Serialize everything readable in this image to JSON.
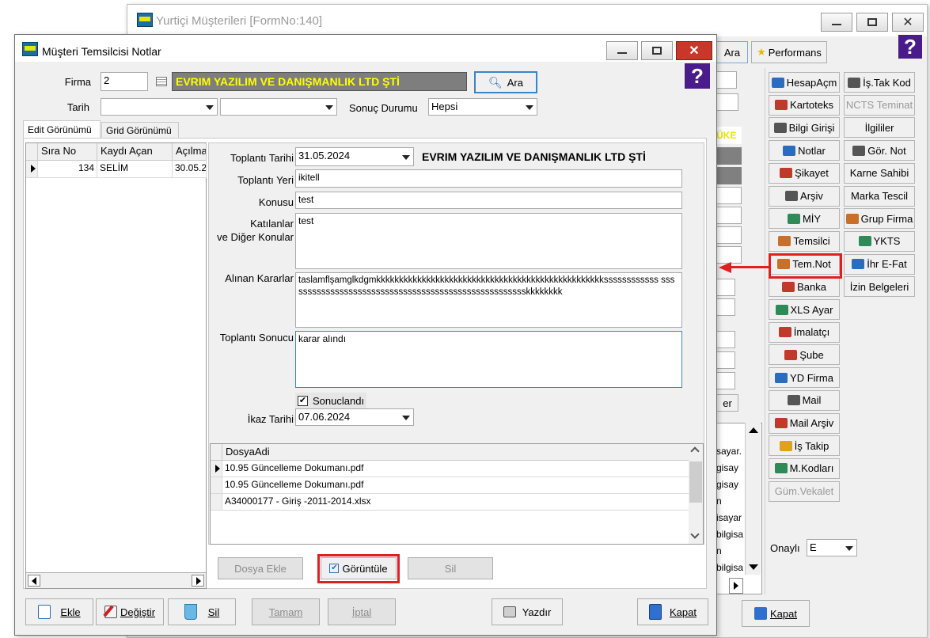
{
  "back_window": {
    "title": "Yurtiçi Müşterileri [FormNo:140]",
    "tab_ara": "Ara",
    "tab_performans": "Performans",
    "yellow_label": "ÜKE",
    "right_buttons_col1": [
      "HesapAçm",
      "Kartoteks",
      "Bilgi Girişi",
      "Notlar",
      "Şikayet",
      "Arşiv",
      "MİY",
      "Temsilci",
      "Tem.Not",
      "Banka",
      "XLS Ayar",
      "İmalatçı",
      "Şube",
      "YD Firma",
      "Mail",
      "Mail Arşiv",
      "İş Takip",
      "M.Kodları",
      "Güm.Vekalet"
    ],
    "right_buttons_col2": [
      "İş.Tak Kod",
      "NCTS Teminat",
      "İlgililer",
      "Gör. Not",
      "Karne Sahibi",
      "Marka Tescil",
      "Grup Firma",
      "YKTS",
      "İhr E-Fat",
      "İzin Belgeleri"
    ],
    "onayli_label": "Onaylı",
    "onayli_value": "E",
    "list_items": [
      "sayar.",
      "gisay",
      "gisay",
      "n",
      "isayar",
      "bilgisa",
      "n",
      "bilgisa"
    ],
    "er_button": "er",
    "kapat": "Kapat"
  },
  "front_window": {
    "title": "Müşteri Temsilcisi Notlar",
    "firma_label": "Firma",
    "firma_value": "2",
    "firma_name": "EVRIM YAZILIM VE DANIŞMANLIK LTD ŞTİ",
    "ara_button": "Ara",
    "tarih_label": "Tarih",
    "sonuc_durumu_label": "Sonuç Durumu",
    "sonuc_durumu_value": "Hepsi",
    "tabs": [
      "Edit Görünümü",
      "Grid Görünümü"
    ],
    "grid": {
      "headers": [
        "Sıra No",
        "Kaydı Açan",
        "Açılma"
      ],
      "rows": [
        [
          "134",
          "SELİM",
          "30.05.2"
        ]
      ]
    },
    "form": {
      "toplanti_tarihi_label": "Toplantı Tarihi",
      "toplanti_tarihi_value": "31.05.2024",
      "company_label": "EVRIM YAZILIM VE DANIŞMANLIK LTD ŞTİ",
      "toplanti_yeri_label": "Toplantı Yeri",
      "toplanti_yeri_value": "ikitell",
      "konusu_label": "Konusu",
      "konusu_value": "test",
      "katilanlar_label_1": "Katılanlar",
      "katilanlar_label_2": "ve Diğer Konular",
      "katilanlar_value": "test",
      "alinan_kararlar_label": "Alınan Kararlar",
      "alinan_kararlar_value": "taslamflşamglkdgmkkkkkkkkkkkkkkkkkkkkkkkkkkkkkkkkkkkkkkkkkkkkkkkkkkssssssssssss ssssssssssssssssssssssssssssssssssssssssssssssssssssskkkkkkkk",
      "toplanti_sonucu_label": "Toplantı Sonucu",
      "toplanti_sonucu_value": "karar alındı",
      "sonuclandi_label": "Sonuclandı",
      "ikaz_tarihi_label": "İkaz Tarihi",
      "ikaz_tarihi_value": "07.06.2024"
    },
    "files": {
      "header": "DosyaAdi",
      "items": [
        "10.95 Güncelleme Dokumanı.pdf",
        "10.95 Güncelleme Dokumanı.pdf",
        "A34000177 - Giriş -2011-2014.xlsx"
      ]
    },
    "file_buttons": {
      "ekle": "Dosya Ekle",
      "goruntule": "Görüntüle",
      "sil": "Sil"
    },
    "bottom_buttons": {
      "ekle": "Ekle",
      "degistir": "Değiştir",
      "sil": "Sil",
      "tamam": "Tamam",
      "iptal": "İptal",
      "yazdir": "Yazdır",
      "kapat": "Kapat"
    }
  }
}
